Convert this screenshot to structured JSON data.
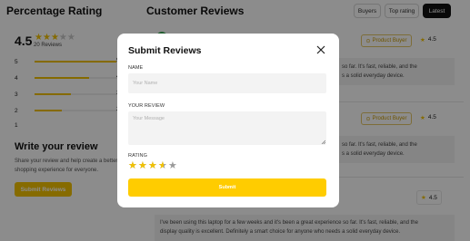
{
  "left_panel": {
    "title": "Percentage Rating",
    "score": "4.5",
    "review_count": "20 Reviews",
    "rating_rows": [
      {
        "stars": "5",
        "count": "9",
        "fill": 0.9
      },
      {
        "stars": "4",
        "count": "4",
        "fill": 0.6
      },
      {
        "stars": "3",
        "count": "3",
        "fill": 0.4
      },
      {
        "stars": "2",
        "count": "2",
        "fill": 0.3
      },
      {
        "stars": "1",
        "count": "",
        "fill": 0
      }
    ],
    "write_title": "Write your review",
    "write_desc": "Share your review and help create a better shopping experience for everyone.",
    "submit_label": "Submit Reviews"
  },
  "reviews_panel": {
    "title": "Customer Reviews",
    "tabs": [
      {
        "label": "Buyers",
        "active": false
      },
      {
        "label": "Top rating",
        "active": false
      },
      {
        "label": "Latest",
        "active": true
      }
    ],
    "badge_label": "Product Buyer",
    "rating_value": "4.5",
    "review_snippet": "so far. It's fast, reliable, and the",
    "review_snippet_2": "s a solid everyday device.",
    "review_full_1": "I've been using this laptop for a few weeks and it's been a great experience so far. It's fast, reliable, and the",
    "review_full_2": "display quality is excellent. Definitely a smart choice for anyone who needs a solid everyday device."
  },
  "modal": {
    "title": "Submit Reviews",
    "name_label": "NAME",
    "name_placeholder": "Your Name",
    "review_label": "YOUR REVIEW",
    "review_placeholder": "Your Message",
    "rating_label": "RATING",
    "rating_value": 3.5,
    "submit_label": "Submit"
  },
  "colors": {
    "accent": "#ffcc00",
    "star_on": "#f2c200",
    "star_off": "#9a9a9a"
  }
}
